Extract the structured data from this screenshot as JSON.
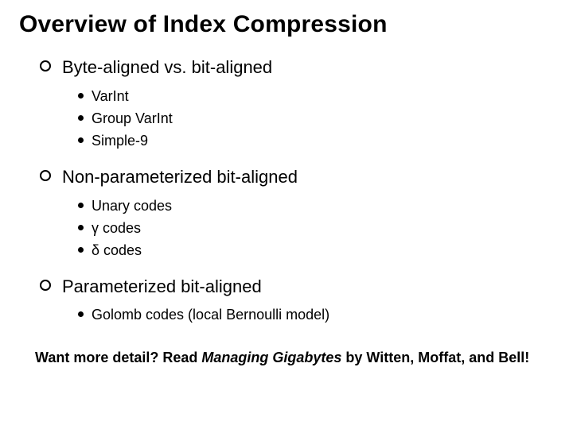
{
  "title": "Overview of Index Compression",
  "sections": [
    {
      "heading": "Byte-aligned vs. bit-aligned",
      "items": [
        "VarInt",
        "Group VarInt",
        "Simple-9"
      ]
    },
    {
      "heading": "Non-parameterized bit-aligned",
      "items": [
        "Unary codes",
        "γ codes",
        "δ codes"
      ]
    },
    {
      "heading": "Parameterized bit-aligned",
      "items": [
        "Golomb codes (local Bernoulli model)"
      ]
    }
  ],
  "footer": {
    "prefix": "Want more detail? Read ",
    "book": "Managing Gigabytes",
    "suffix": " by Witten, Moffat, and Bell!"
  }
}
